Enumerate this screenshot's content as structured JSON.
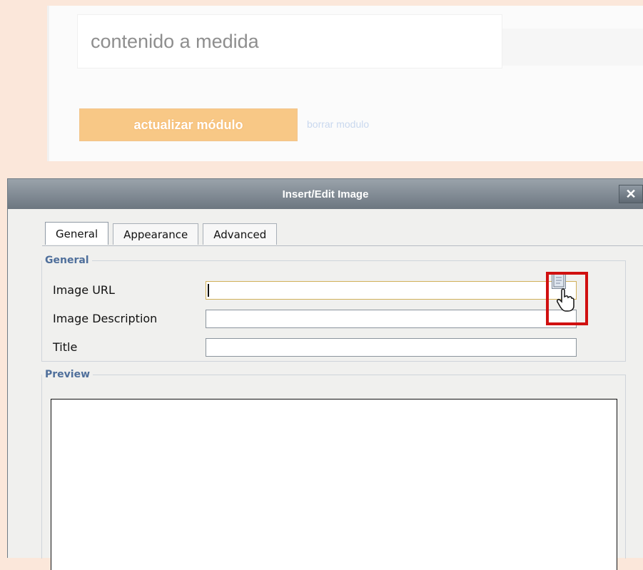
{
  "background": {
    "content_field_value": "contenido a medida",
    "update_button_label": "actualizar módulo",
    "delete_link_label": "borrar modulo"
  },
  "dialog": {
    "title": "Insert/Edit Image",
    "close_label": "✕",
    "tabs": [
      {
        "label": "General",
        "active": true
      },
      {
        "label": "Appearance",
        "active": false
      },
      {
        "label": "Advanced",
        "active": false
      }
    ],
    "general_legend": "General",
    "fields": [
      {
        "label": "Image URL",
        "value": ""
      },
      {
        "label": "Image Description",
        "value": ""
      },
      {
        "label": "Title",
        "value": ""
      }
    ],
    "browse_icon": "browse-icon",
    "preview_legend": "Preview"
  },
  "colors": {
    "accent_orange": "#f8c886",
    "titlebar": "#7f8992",
    "highlight_red": "#d01010",
    "legend_blue": "#4f6f9b"
  }
}
